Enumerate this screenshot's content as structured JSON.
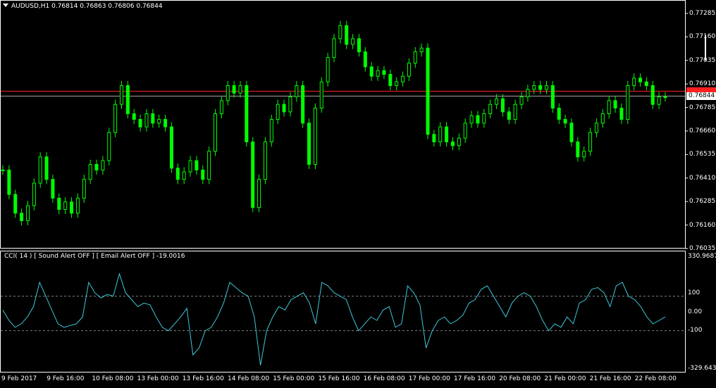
{
  "symbol_header": "AUDUSD,H1  0.76814 0.76863 0.76806 0.76844",
  "price_axis": [
    "0.77285",
    "0.77160",
    "0.77035",
    "0.76910",
    "0.76785",
    "0.76660",
    "0.76535",
    "0.76410",
    "0.76285",
    "0.76160",
    "0.76035"
  ],
  "current_price": "0.76844",
  "red_line_price": "0.76870",
  "indicator_header": "CCI( 14 ) [ Sound Alert OFF ] [ Email Alert OFF ] -19.0016",
  "indicator_axis": {
    "max": "330.9687",
    "upper": "100",
    "zero": "0.00",
    "lower": "-100",
    "min": "-329.6433"
  },
  "time_axis": [
    "9 Feb 2017",
    "9 Feb 16:00",
    "10 Feb 08:00",
    "13 Feb 00:00",
    "13 Feb 16:00",
    "14 Feb 08:00",
    "15 Feb 00:00",
    "15 Feb 16:00",
    "16 Feb 08:00",
    "17 Feb 00:00",
    "17 Feb 16:00",
    "20 Feb 08:00",
    "21 Feb 00:00",
    "21 Feb 16:00",
    "22 Feb 08:00"
  ],
  "colors": {
    "candle": "#00ff00",
    "cci_line": "#3ec8d8",
    "level_line": "#ff2020",
    "grid": "#808080"
  },
  "chart_data": [
    {
      "type": "line",
      "title": "AUDUSD,H1",
      "ylim": [
        0.76035,
        0.77285
      ],
      "close": [
        0.7645,
        0.7632,
        0.7622,
        0.7618,
        0.7626,
        0.7638,
        0.7652,
        0.764,
        0.763,
        0.7624,
        0.7628,
        0.7622,
        0.763,
        0.764,
        0.7648,
        0.7645,
        0.765,
        0.7665,
        0.768,
        0.769,
        0.7675,
        0.7672,
        0.7668,
        0.7675,
        0.767,
        0.7672,
        0.7668,
        0.7646,
        0.764,
        0.7644,
        0.765,
        0.7645,
        0.764,
        0.7655,
        0.7675,
        0.7682,
        0.769,
        0.7686,
        0.769,
        0.766,
        0.7625,
        0.764,
        0.766,
        0.7672,
        0.768,
        0.7676,
        0.7684,
        0.769,
        0.767,
        0.7648,
        0.7678,
        0.7692,
        0.7705,
        0.7715,
        0.7722,
        0.7712,
        0.7715,
        0.7708,
        0.77,
        0.7695,
        0.7698,
        0.7696,
        0.769,
        0.7692,
        0.7695,
        0.7702,
        0.7708,
        0.771,
        0.7664,
        0.766,
        0.7668,
        0.766,
        0.7658,
        0.7662,
        0.767,
        0.7674,
        0.767,
        0.7675,
        0.768,
        0.7683,
        0.7676,
        0.7672,
        0.768,
        0.7684,
        0.7688,
        0.769,
        0.7688,
        0.769,
        0.7678,
        0.7672,
        0.767,
        0.766,
        0.7652,
        0.7655,
        0.7665,
        0.767,
        0.7675,
        0.7682,
        0.7678,
        0.7672,
        0.769,
        0.7694,
        0.7692,
        0.769,
        0.768,
        0.7684,
        0.7684
      ]
    },
    {
      "type": "line",
      "title": "CCI( 14 )",
      "ylim": [
        -329.6433,
        330.9687
      ],
      "levels": [
        100,
        0,
        -100
      ],
      "series": [
        {
          "name": "CCI( 14 )",
          "values": [
            20,
            -40,
            -80,
            -60,
            -20,
            40,
            180,
            100,
            20,
            -60,
            -80,
            -70,
            -60,
            -20,
            180,
            120,
            90,
            110,
            100,
            230,
            120,
            80,
            40,
            60,
            50,
            -20,
            -80,
            -100,
            -60,
            -20,
            30,
            -240,
            -200,
            -100,
            -80,
            -20,
            60,
            180,
            150,
            120,
            100,
            -20,
            -300,
            -100,
            -20,
            40,
            20,
            80,
            100,
            120,
            60,
            -60,
            180,
            160,
            120,
            100,
            80,
            -20,
            -100,
            -60,
            -20,
            -40,
            20,
            40,
            -80,
            -60,
            160,
            120,
            50,
            -200,
            -100,
            -40,
            -20,
            -60,
            -40,
            -10,
            60,
            80,
            140,
            160,
            100,
            40,
            -20,
            60,
            100,
            120,
            100,
            40,
            -40,
            -100,
            -60,
            -80,
            -20,
            -60,
            60,
            80,
            140,
            150,
            120,
            40,
            160,
            180,
            100,
            80,
            40,
            -20,
            -60,
            -40,
            -20
          ]
        }
      ]
    }
  ]
}
